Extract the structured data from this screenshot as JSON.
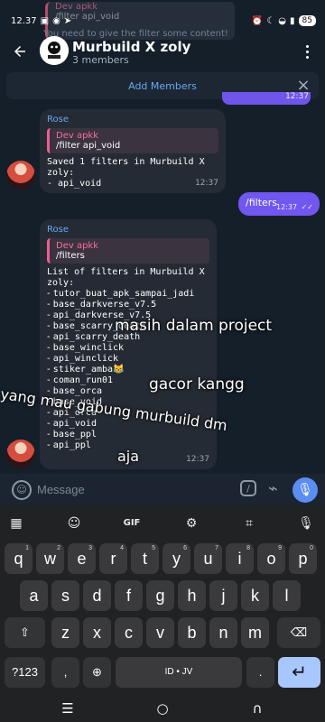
{
  "status": {
    "time": "12.37",
    "left_icons": [
      "notification-icon",
      "chat-icon",
      "telegram-icon"
    ],
    "right_icons": [
      "alarm-icon",
      "moon-icon",
      "wifi-icon",
      "signal-icon"
    ],
    "battery": "85"
  },
  "background": {
    "quote_name": "Dev apkk",
    "quote_text": "/filter api_void",
    "underlay_text": "You need to give the filter some content!"
  },
  "header": {
    "title": "Murbuild X zoly",
    "subtitle": "3 members"
  },
  "banner": {
    "label": "Add Members",
    "hidden_time": "12:37"
  },
  "messages": [
    {
      "sender": "Rose",
      "reply_name": "Dev apkk",
      "reply_text": "/filter api_void",
      "text_line1": "Saved 1 filters in Murbuild X zoly:",
      "text_line2": "- api_void",
      "time": "12:37"
    },
    {
      "text": "/filters",
      "time": "12:37",
      "status": "✓✓"
    },
    {
      "sender": "Rose",
      "reply_name": "Dev apkk",
      "reply_text": "/filters",
      "heading": "List of filters in Murbuild X zoly:",
      "items": [
        "tutor_buat_apk_sampai_jadi",
        "base_darkverse_v7.5",
        "api_darkverse_v7.5",
        "base_scarry_death",
        "api_scarry_death",
        "base_winclick",
        "api_winclick",
        "stiker_amba😹",
        "coman_run01",
        "base_orca",
        "base_void",
        "api_orca",
        "api_void",
        "base_ppl",
        "api_ppl"
      ],
      "time": "12:37"
    }
  ],
  "overlays": [
    "masih dalam project",
    "gacor kangg",
    "yang mau gabung murbuild dm",
    "aja"
  ],
  "composer": {
    "placeholder": "Message"
  },
  "keyboard": {
    "toolbar": [
      "apps-icon",
      "sticker-icon",
      "GIF",
      "gear-icon",
      "translate-icon",
      "mic-icon"
    ],
    "row1": [
      {
        "label": "q",
        "num": "1"
      },
      {
        "label": "w",
        "num": "2"
      },
      {
        "label": "e",
        "num": "3"
      },
      {
        "label": "r",
        "num": "4"
      },
      {
        "label": "t",
        "num": "5"
      },
      {
        "label": "y",
        "num": "6"
      },
      {
        "label": "u",
        "num": "7"
      },
      {
        "label": "i",
        "num": "8"
      },
      {
        "label": "o",
        "num": "9"
      },
      {
        "label": "p",
        "num": "0"
      }
    ],
    "row2": [
      "a",
      "s",
      "d",
      "f",
      "g",
      "h",
      "j",
      "k",
      "l"
    ],
    "row3": [
      "z",
      "x",
      "c",
      "v",
      "b",
      "n",
      "m"
    ],
    "bottom": {
      "symbols": "?123",
      "comma": ",",
      "space": "ID • JV",
      "period": "."
    }
  },
  "colors": {
    "accent": "#66a9f2",
    "outgoing": "#7057f0",
    "reply_border": "#ef5d91",
    "enter_key": "#a9c7ff"
  }
}
